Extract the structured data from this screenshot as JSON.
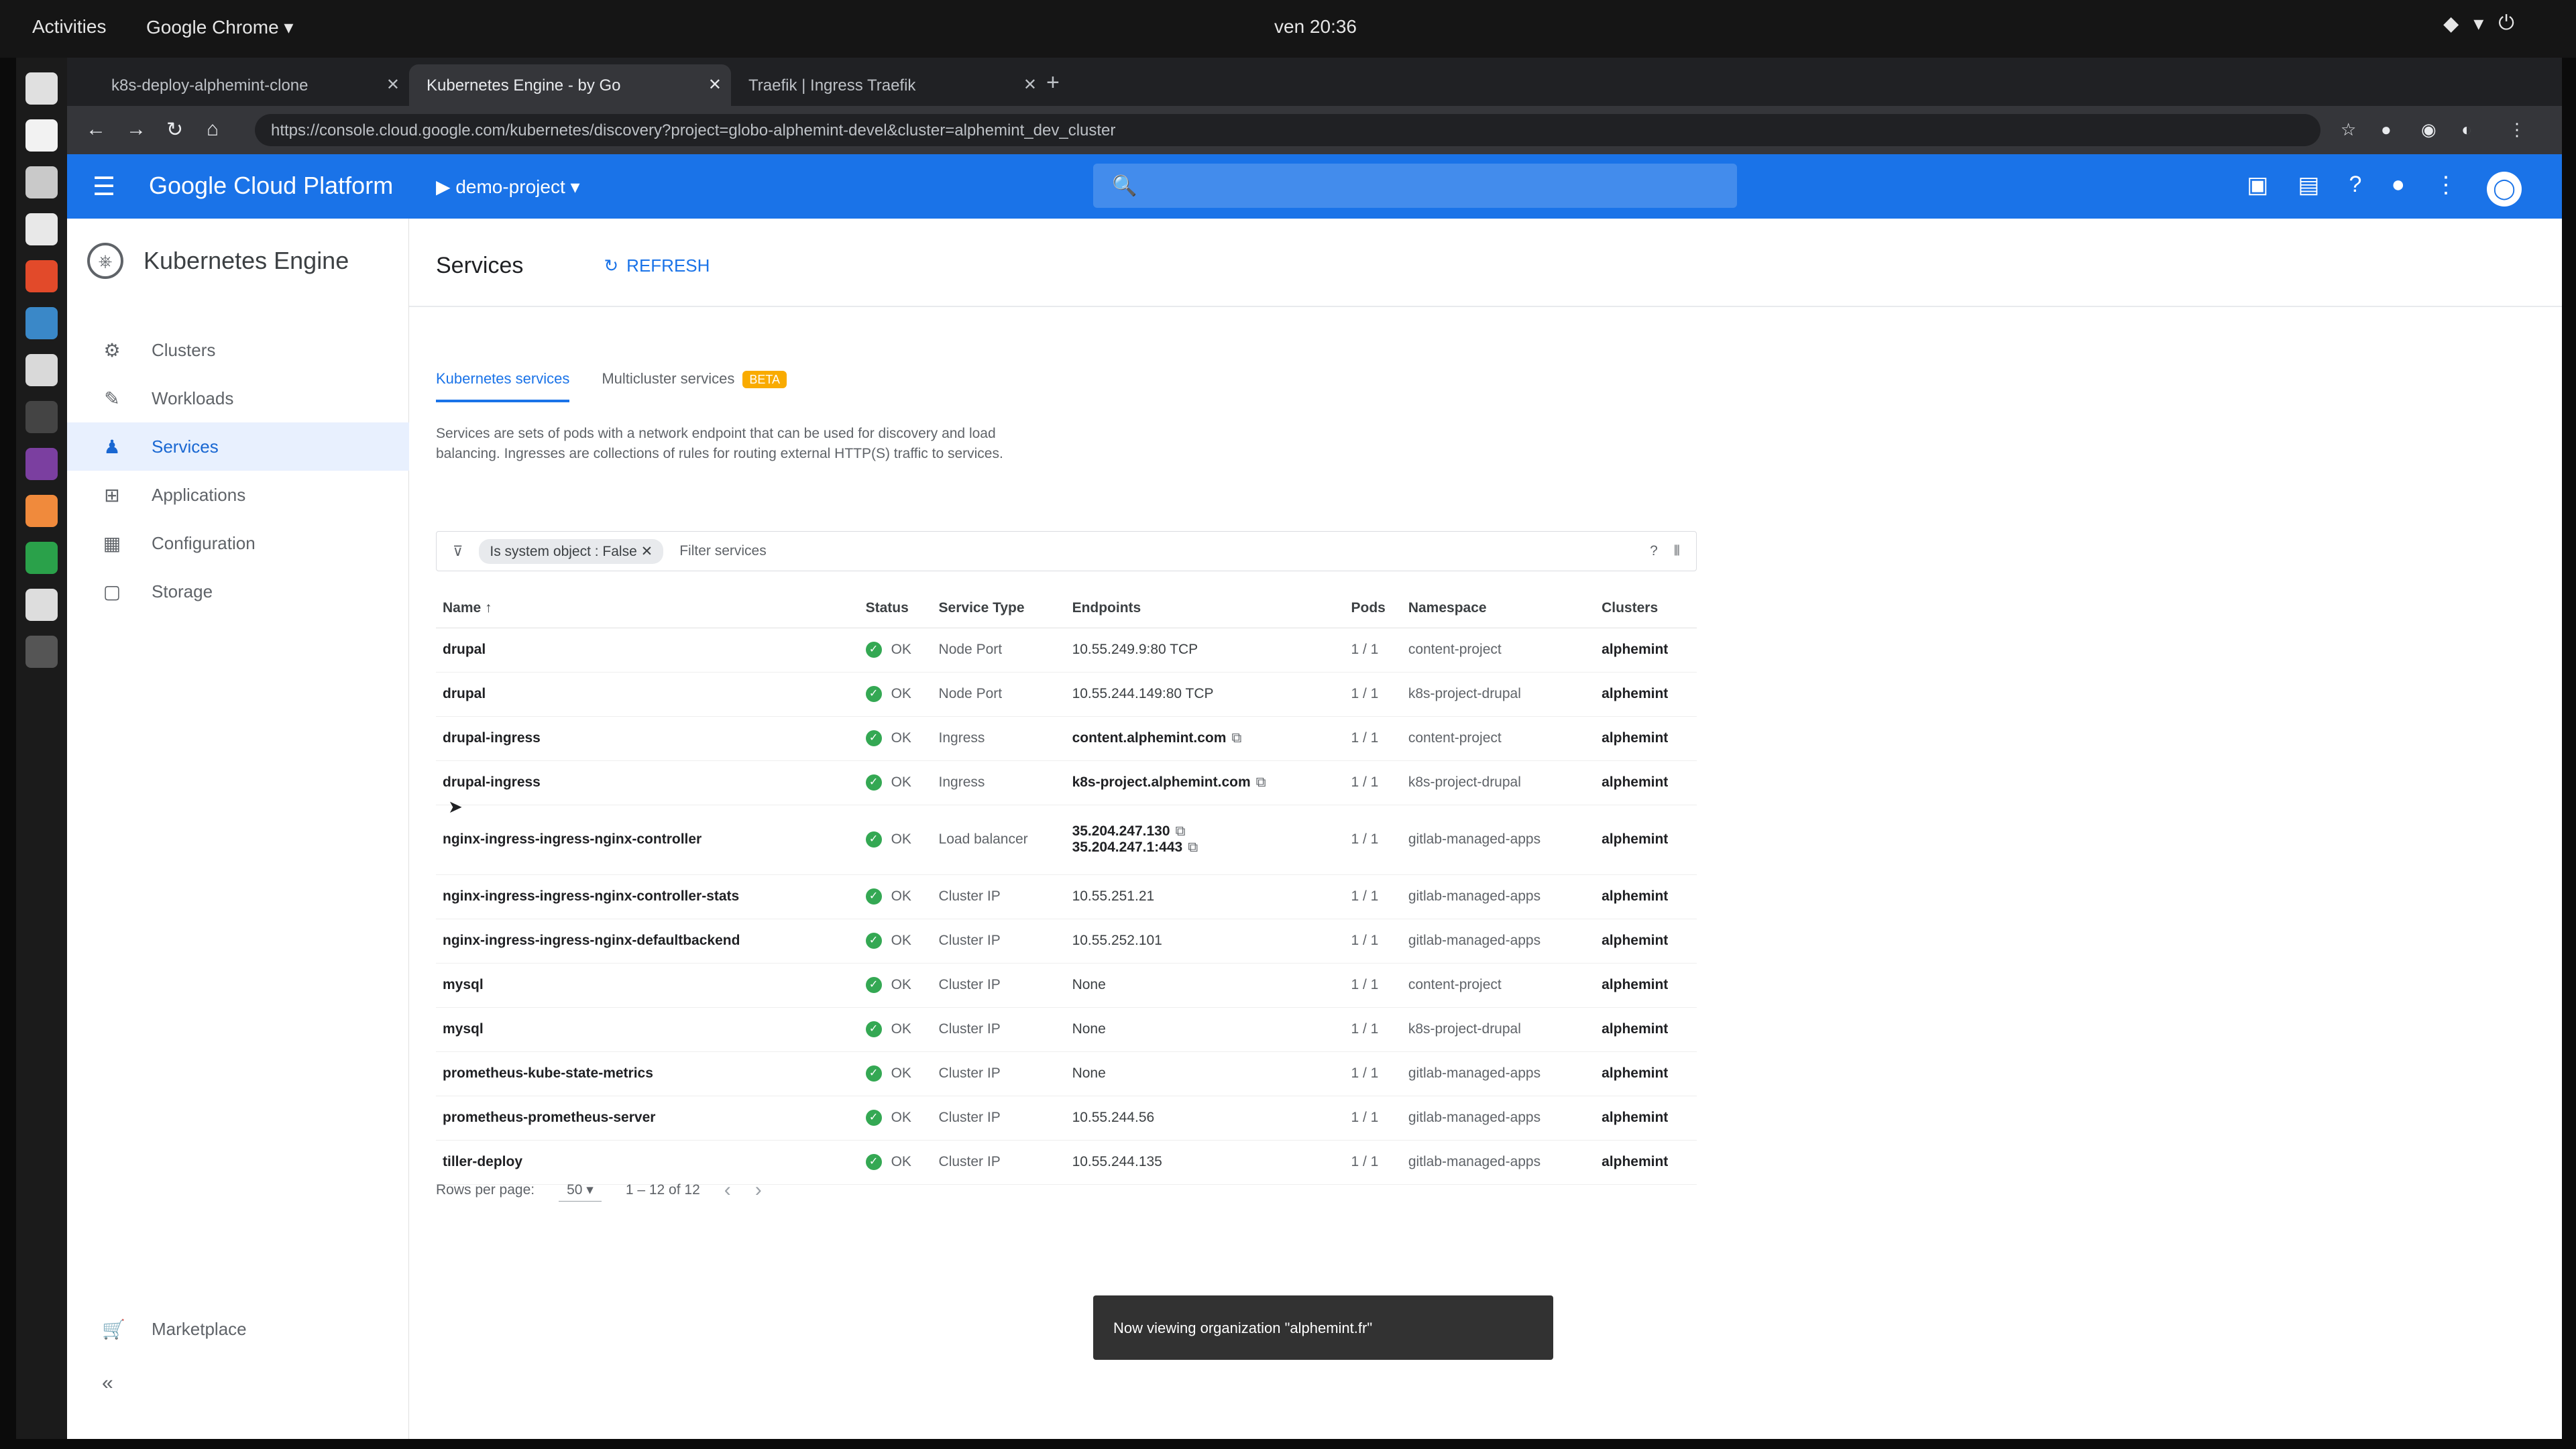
{
  "os": {
    "activities": "Activities",
    "app_menu": "Google Chrome ▾",
    "clock": "ven 20:36",
    "status_icons": [
      "volume-icon",
      "network-icon",
      "power-icon"
    ]
  },
  "browser": {
    "tabs": [
      {
        "label": "k8s-deploy-alphemint-clone"
      },
      {
        "label": "Kubernetes Engine - by Go"
      },
      {
        "label": "Traefik | Ingress Traefik"
      }
    ],
    "url": "https://console.cloud.google.com/kubernetes/discovery?project=globo-alphemint-devel&cluster=alphemint_dev_cluster"
  },
  "gcp": {
    "title": "Google Cloud Platform",
    "project": "▶ demo-project ▾",
    "search_placeholder": "🔍"
  },
  "leftnav": {
    "product": "Kubernetes Engine",
    "items": [
      {
        "label": "Clusters"
      },
      {
        "label": "Workloads"
      },
      {
        "label": "Services"
      },
      {
        "label": "Applications"
      },
      {
        "label": "Configuration"
      },
      {
        "label": "Storage"
      }
    ],
    "marketplace": "Marketplace"
  },
  "main": {
    "title": "Services",
    "refresh": "REFRESH",
    "tabs": [
      {
        "label": "Kubernetes services"
      },
      {
        "label": "Multicluster services"
      }
    ],
    "beta_badge": "BETA",
    "description": "Services are sets of pods with a network endpoint that can be used for discovery and load balancing. Ingresses are collections of rules for routing external HTTP(S) traffic to services.",
    "filter_chip": "Is system object : False ✕",
    "filter_placeholder": "Filter services",
    "columns": [
      "Name ↑",
      "Status",
      "Service Type",
      "Endpoints",
      "Pods",
      "Namespace",
      "Clusters"
    ],
    "rows": [
      {
        "name": "drupal",
        "status": "OK",
        "type": "Node Port",
        "endpoints": [
          "10.55.249.9:80 TCP"
        ],
        "pods": "1 / 1",
        "namespace": "content-project",
        "cluster": "alphemint"
      },
      {
        "name": "drupal",
        "status": "OK",
        "type": "Node Port",
        "endpoints": [
          "10.55.244.149:80 TCP"
        ],
        "pods": "1 / 1",
        "namespace": "k8s-project-drupal",
        "cluster": "alphemint"
      },
      {
        "name": "drupal-ingress",
        "status": "OK",
        "type": "Ingress",
        "endpoints": [
          "content.alphemint.com"
        ],
        "pods": "1 / 1",
        "namespace": "content-project",
        "cluster": "alphemint"
      },
      {
        "name": "drupal-ingress",
        "status": "OK",
        "type": "Ingress",
        "endpoints": [
          "k8s-project.alphemint.com"
        ],
        "pods": "1 / 1",
        "namespace": "k8s-project-drupal",
        "cluster": "alphemint"
      },
      {
        "name": "nginx-ingress-ingress-nginx-controller",
        "status": "OK",
        "type": "Load balancer",
        "endpoints": [
          "35.204.247.130",
          "35.204.247.1:443"
        ],
        "pods": "1 / 1",
        "namespace": "gitlab-managed-apps",
        "cluster": "alphemint"
      },
      {
        "name": "nginx-ingress-ingress-nginx-controller-stats",
        "status": "OK",
        "type": "Cluster IP",
        "endpoints": [
          "10.55.251.21"
        ],
        "pods": "1 / 1",
        "namespace": "gitlab-managed-apps",
        "cluster": "alphemint"
      },
      {
        "name": "nginx-ingress-ingress-nginx-defaultbackend",
        "status": "OK",
        "type": "Cluster IP",
        "endpoints": [
          "10.55.252.101"
        ],
        "pods": "1 / 1",
        "namespace": "gitlab-managed-apps",
        "cluster": "alphemint"
      },
      {
        "name": "mysql",
        "status": "OK",
        "type": "Cluster IP",
        "endpoints": [
          "None"
        ],
        "pods": "1 / 1",
        "namespace": "content-project",
        "cluster": "alphemint"
      },
      {
        "name": "mysql",
        "status": "OK",
        "type": "Cluster IP",
        "endpoints": [
          "None"
        ],
        "pods": "1 / 1",
        "namespace": "k8s-project-drupal",
        "cluster": "alphemint"
      },
      {
        "name": "prometheus-kube-state-metrics",
        "status": "OK",
        "type": "Cluster IP",
        "endpoints": [
          "None"
        ],
        "pods": "1 / 1",
        "namespace": "gitlab-managed-apps",
        "cluster": "alphemint"
      },
      {
        "name": "prometheus-prometheus-server",
        "status": "OK",
        "type": "Cluster IP",
        "endpoints": [
          "10.55.244.56"
        ],
        "pods": "1 / 1",
        "namespace": "gitlab-managed-apps",
        "cluster": "alphemint"
      },
      {
        "name": "tiller-deploy",
        "status": "OK",
        "type": "Cluster IP",
        "endpoints": [
          "10.55.244.135"
        ],
        "pods": "1 / 1",
        "namespace": "gitlab-managed-apps",
        "cluster": "alphemint"
      }
    ],
    "pager": {
      "rows_per_page_label": "Rows per page:",
      "rows_per_page": "50 ▾",
      "range": "1 – 12 of 12"
    }
  },
  "snackbar": "Now viewing organization \"alphemint.fr\"",
  "colors": {
    "gcp_blue": "#1a73e8",
    "ok_green": "#34a853",
    "beta_orange": "#f9ab00"
  }
}
